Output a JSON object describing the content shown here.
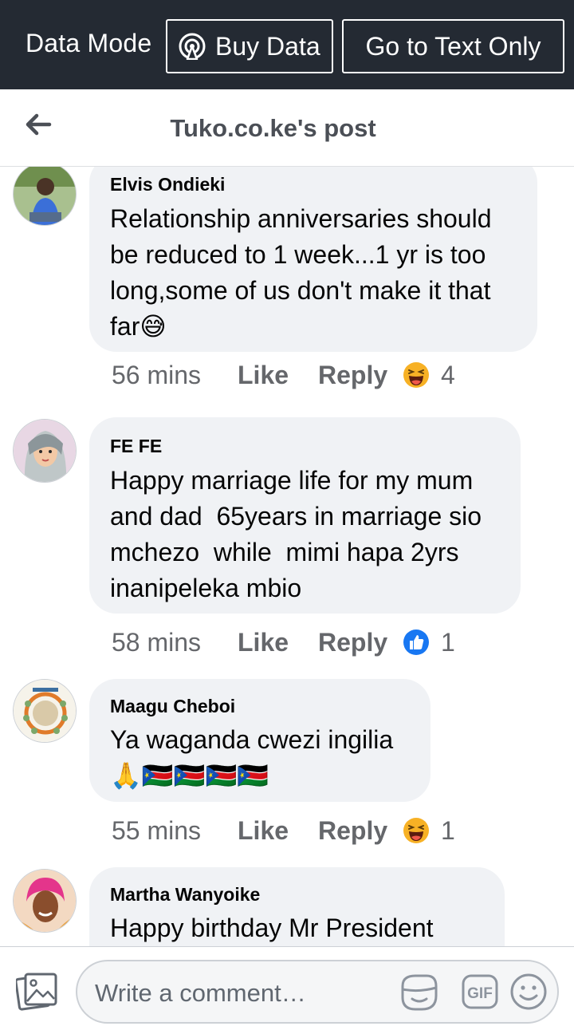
{
  "databar": {
    "mode_label": "Data Mode",
    "buy_label": "Buy Data",
    "text_only_label": "Go to Text Only"
  },
  "header": {
    "title": "Tuko.co.ke's post"
  },
  "comments": [
    {
      "author": "Elvis Ondieki",
      "text": "Relationship anniversaries should\nbe reduced to 1 week...1 yr is too\nlong,some of us don't make it that\nfar😅",
      "time": "56 mins",
      "like": "Like",
      "reply": "Reply",
      "reaction": "haha-icon",
      "reaction_count": "4"
    },
    {
      "author": "FE FE",
      "text": "Happy marriage life for my mum\nand dad  65years in marriage sio\nmchezo  while  mimi hapa 2yrs\ninanipeleka mbio",
      "time": "58 mins",
      "like": "Like",
      "reply": "Reply",
      "reaction": "thumbs-up-icon",
      "reaction_count": "1"
    },
    {
      "author": "Maagu Cheboi",
      "text": "Ya waganda cwezi ingilia\n🙏🇸🇸🇸🇸🇸🇸🇸🇸",
      "time": "55 mins",
      "like": "Like",
      "reply": "Reply",
      "reaction": "haha-icon",
      "reaction_count": "1"
    },
    {
      "author": "Martha Wanyoike",
      "text": "Happy birthday Mr President"
    }
  ],
  "composer": {
    "placeholder": "Write a comment…",
    "gif_label": "GIF"
  },
  "colors": {
    "databar_bg": "#242a33",
    "bubble_bg": "#f0f2f5",
    "meta_text": "#65676b",
    "like_blue": "#1877f2",
    "haha_yellow": "#f7b125"
  }
}
